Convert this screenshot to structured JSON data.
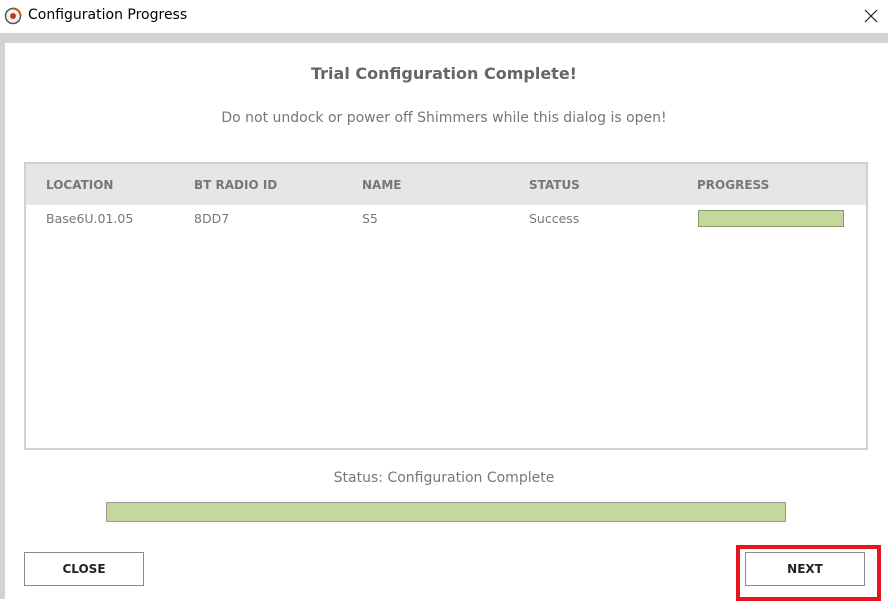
{
  "window": {
    "title": "Configuration Progress",
    "icon": "shimmer-app-icon",
    "close_icon": "close-icon"
  },
  "dialog": {
    "heading": "Trial Configuration Complete!",
    "warning": "Do not undock or power off Shimmers while this dialog is open!"
  },
  "table": {
    "headers": [
      "LOCATION",
      "BT RADIO ID",
      "NAME",
      "STATUS",
      "PROGRESS"
    ],
    "rows": [
      {
        "location": "Base6U.01.05",
        "bt_radio_id": "8DD7",
        "name": "S5",
        "status": "Success",
        "progress": 1.0
      }
    ]
  },
  "status": {
    "text": "Status: Configuration Complete",
    "overall_progress": 1.0
  },
  "buttons": {
    "close_label": "CLOSE",
    "next_label": "NEXT"
  },
  "colors": {
    "progress_fill": "#c5d89c",
    "highlight": "#e5141f",
    "header_bg": "#e6e6e6"
  }
}
